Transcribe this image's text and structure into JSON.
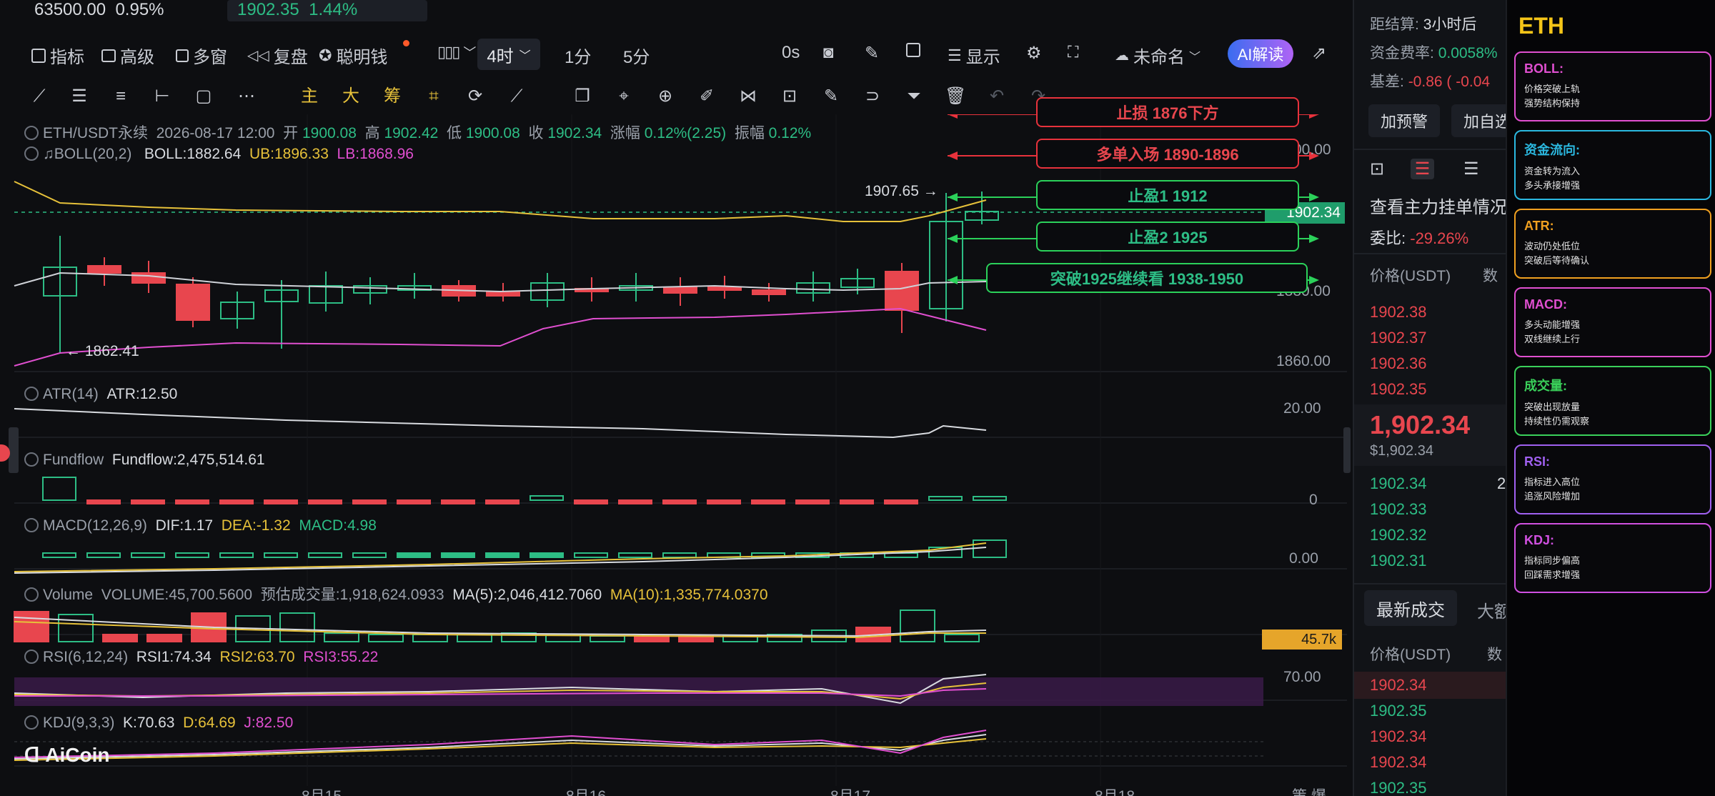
{
  "top": {
    "btc_price": "63500.00",
    "btc_change": "0.95%",
    "eth_price": "1902.35",
    "eth_change": "1.44%"
  },
  "toolbar": {
    "indicators": "指标",
    "advanced": "高级",
    "multi_window": "多窗",
    "replay": "复盘",
    "smart_money": "聪明钱",
    "active_timeframe": "4时",
    "tf_1m": "1分",
    "tf_5m": "5分",
    "tf_0s": "0s",
    "display": "显示",
    "layout_name": "未命名",
    "ai_button": "AI解读"
  },
  "toolbar2": {
    "main": "主",
    "big": "大",
    "chip": "筹"
  },
  "chart": {
    "ohlc_line": {
      "symbol": "ETH/USDT永续",
      "time": "2026-08-17 12:00",
      "open_label": "开",
      "open": "1900.08",
      "high_label": "高",
      "high": "1902.42",
      "low_label": "低",
      "low": "1900.08",
      "close_label": "收",
      "close": "1902.34",
      "change_label": "涨幅",
      "change": "0.12%(2.25)",
      "amp_label": "振幅",
      "amp": "0.12%"
    },
    "boll": {
      "name": "BOLL(20,2)",
      "boll": "BOLL:1882.64",
      "ub": "UB:1896.33",
      "lb": "LB:1868.96"
    },
    "atr": {
      "name": "ATR(14)",
      "value": "ATR:12.50"
    },
    "fundflow": {
      "name": "Fundflow",
      "value": "Fundflow:2,475,514.61"
    },
    "macd": {
      "name": "MACD(12,26,9)",
      "dif": "DIF:1.17",
      "dea": "DEA:-1.32",
      "macd": "MACD:4.98"
    },
    "volume": {
      "name": "Volume",
      "value": "VOLUME:45,700.5600",
      "est": "预估成交量:1,918,624.0933",
      "ma5": "MA(5):2,046,412.7060",
      "ma10": "MA(10):1,335,774.0370"
    },
    "rsi": {
      "name": "RSI(6,12,24)",
      "rsi1": "RSI1:74.34",
      "rsi2": "RSI2:63.70",
      "rsi3": "RSI3:55.22"
    },
    "kdj": {
      "name": "KDJ(9,3,3)",
      "k": "K:70.63",
      "d": "D:64.69",
      "j": "J:82.50"
    },
    "axis": {
      "main_top": "00.00",
      "current_price": "1902.34",
      "mid": "1880.00",
      "low": "1860.00",
      "atr": "20.00",
      "fundflow": "0",
      "macd": "0.00",
      "volume": "45.7k",
      "rsi": "70.00"
    },
    "x_labels": [
      "8月15",
      "8月16",
      "8月17",
      "8月18"
    ],
    "bottom_right": "策 爆",
    "high_marker": "1907.65",
    "low_marker": "← 1862.41",
    "watermark": "AiCoin"
  },
  "annotations": [
    {
      "text": "止损 1876下方",
      "color": "red"
    },
    {
      "text": "多单入场 1890-1896",
      "color": "red"
    },
    {
      "text": "止盈1 1912",
      "color": "green"
    },
    {
      "text": "止盈2 1925",
      "color": "green"
    },
    {
      "text": "突破1925继续看 1938-1950",
      "color": "green"
    }
  ],
  "colors": {
    "up": "#2dbd85",
    "down": "#e8464e",
    "annot_red": "#e8323c",
    "annot_green": "#2bd15a",
    "boll_mid": "#cfd2d8",
    "boll_ub": "#e6c13a",
    "boll_lb": "#e04fd0"
  },
  "right_panel": {
    "settlement_label": "距结算:",
    "settlement_value": "3小时后",
    "funding_label": "资金费率:",
    "funding_value": "0.0058%",
    "basis_label": "基差:",
    "basis_value": "-0.86 ( -0.04",
    "alert_button": "加预警",
    "watchlist_button": "加自选",
    "orderbook_title": "查看主力挂单情况",
    "ratio_label": "委比:",
    "ratio_value": "-29.26%",
    "price_header": "价格(USDT)",
    "qty_header": "数",
    "asks": [
      "1902.38",
      "1902.37",
      "1902.36",
      "1902.35"
    ],
    "last_price": "1,902.34",
    "last_price_usd": "$1,902.34",
    "bids": [
      "1902.34",
      "1902.33",
      "1902.32",
      "1902.31"
    ],
    "bid_qty_hint": "2",
    "trades_tab": "最新成交",
    "big_tab": "大额",
    "trades_price_header": "价格(USDT)",
    "trades_qty_header": "数",
    "trades": [
      {
        "price": "1902.34",
        "side": "sell"
      },
      {
        "price": "1902.35",
        "side": "buy"
      },
      {
        "price": "1902.34",
        "side": "sell"
      },
      {
        "price": "1902.34",
        "side": "sell"
      },
      {
        "price": "1902.35",
        "side": "buy"
      }
    ]
  },
  "indicator_panel": {
    "title": "ETH",
    "cards": [
      {
        "name": "BOLL:",
        "color": "#e04fd0",
        "lines": [
          "价格突破上轨",
          "强势结构保持"
        ]
      },
      {
        "name": "资金流向:",
        "color": "#2bb8e0",
        "lines": [
          "资金转为流入",
          "多头承接增强"
        ]
      },
      {
        "name": "ATR:",
        "color": "#f0a020",
        "lines": [
          "波动仍处低位",
          "突破后等待确认"
        ]
      },
      {
        "name": "MACD:",
        "color": "#e04fd0",
        "lines": [
          "多头动能增强",
          "双线继续上行"
        ]
      },
      {
        "name": "成交量:",
        "color": "#3ad05a",
        "lines": [
          "突破出现放量",
          "持续性仍需观察"
        ]
      },
      {
        "name": "RSI:",
        "color": "#a060f0",
        "lines": [
          "指标进入高位",
          "追涨风险增加"
        ]
      },
      {
        "name": "KDJ:",
        "color": "#d050e0",
        "lines": [
          "指标同步偏高",
          "回踩需求增强"
        ]
      }
    ]
  }
}
